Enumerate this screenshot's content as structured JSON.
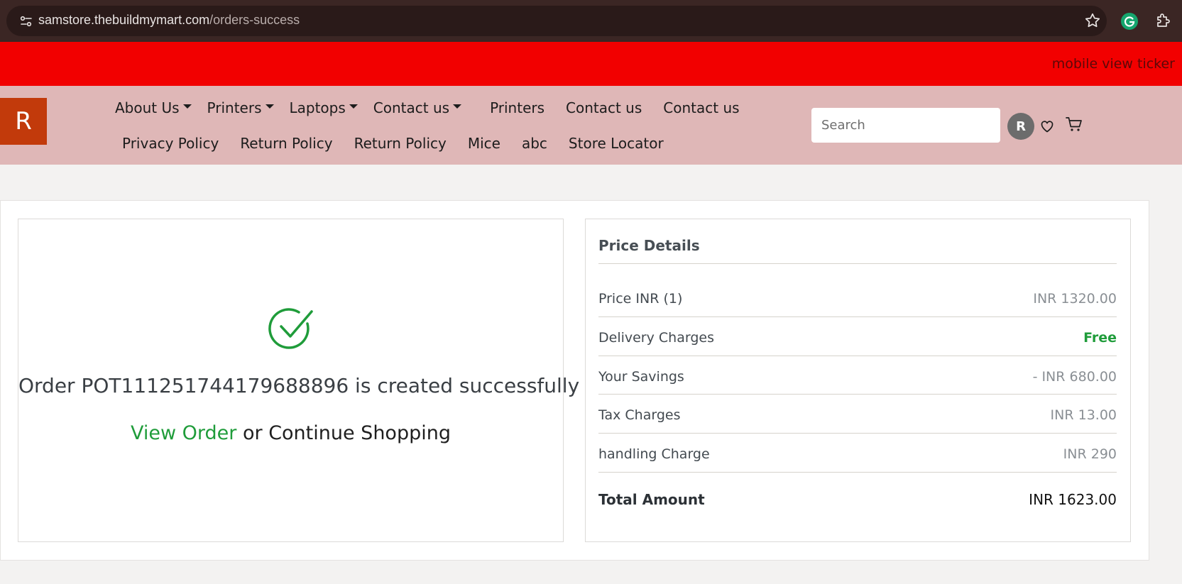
{
  "browser": {
    "url_host": "samstore.thebuildmymart.com",
    "url_path": "/orders-success",
    "icons": [
      "site-settings-icon",
      "bookmark-star-icon",
      "grammarly-icon",
      "extensions-puzzle-icon"
    ]
  },
  "ticker": {
    "text": "mobile view ticker"
  },
  "header": {
    "logo_letter": "R",
    "nav_row1": [
      {
        "label": "About Us",
        "dropdown": true
      },
      {
        "label": "Printers",
        "dropdown": true
      },
      {
        "label": "Laptops",
        "dropdown": true
      },
      {
        "label": "Contact us",
        "dropdown": true
      },
      {
        "label": "Printers",
        "dropdown": false
      },
      {
        "label": "Contact us",
        "dropdown": false
      },
      {
        "label": "Contact us",
        "dropdown": false
      }
    ],
    "nav_row2": [
      {
        "label": "Privacy Policy"
      },
      {
        "label": "Return Policy"
      },
      {
        "label": "Return Policy"
      },
      {
        "label": "Mice"
      },
      {
        "label": "abc"
      },
      {
        "label": "Store Locator"
      }
    ],
    "search_placeholder": "Search",
    "avatar_letter": "R"
  },
  "order": {
    "message": "Order POT111251744179688896 is created successfully",
    "view_order_label": "View Order",
    "or_text": " or ",
    "continue_label": "Continue Shopping"
  },
  "price_details": {
    "title": "Price Details",
    "rows": [
      {
        "label": "Price INR (1)",
        "value": "INR 1320.00"
      },
      {
        "label": "Delivery Charges",
        "value": "Free"
      },
      {
        "label": "Your Savings",
        "value": "- INR 680.00"
      },
      {
        "label": "Tax Charges",
        "value": "INR 13.00"
      },
      {
        "label": "handling Charge",
        "value": "INR 290"
      }
    ],
    "total_label": "Total Amount",
    "total_value": "INR 1623.00"
  },
  "colors": {
    "ticker_bg": "#f20000",
    "navbar_bg": "#dfb7b7",
    "logo_bg": "#c23a0b",
    "success_green": "#1f9c3a"
  }
}
